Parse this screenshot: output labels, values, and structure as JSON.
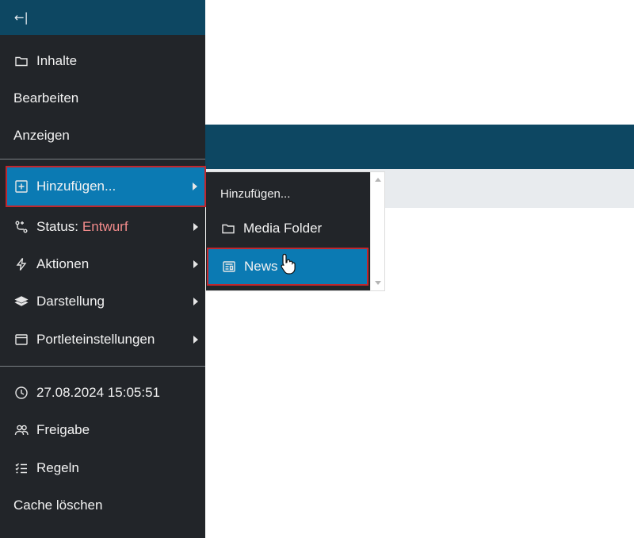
{
  "toolbar": {
    "collapse_label": "←|",
    "items": [
      {
        "label": "Inhalte",
        "icon": "folder-icon"
      },
      {
        "label": "Bearbeiten"
      },
      {
        "label": "Anzeigen"
      },
      {
        "label": "Hinzufügen...",
        "icon": "plus-square-icon",
        "submenu": true,
        "active": true
      },
      {
        "label": "Status:",
        "value": "Entwurf",
        "icon": "workflow-icon",
        "submenu": true
      },
      {
        "label": "Aktionen",
        "icon": "lightning-icon",
        "submenu": true
      },
      {
        "label": "Darstellung",
        "icon": "layers-icon",
        "submenu": true
      },
      {
        "label": "Portleteinstellungen",
        "icon": "window-icon",
        "submenu": true
      },
      {
        "label": "27.08.2024 15:05:51",
        "icon": "clock-icon"
      },
      {
        "label": "Freigabe",
        "icon": "people-icon"
      },
      {
        "label": "Regeln",
        "icon": "list-check-icon"
      },
      {
        "label": "Cache löschen"
      }
    ]
  },
  "submenu": {
    "header": "Hinzufügen...",
    "items": [
      {
        "label": "Media Folder",
        "icon": "folder-icon"
      },
      {
        "label": "News",
        "icon": "newspaper-icon",
        "active": true
      }
    ]
  },
  "colors": {
    "toolbar_bg": "#222529",
    "header_bg": "#0d4762",
    "active_bg": "#0b7ab3",
    "highlight_border": "#c1262d",
    "status_value": "#f28b8b"
  }
}
